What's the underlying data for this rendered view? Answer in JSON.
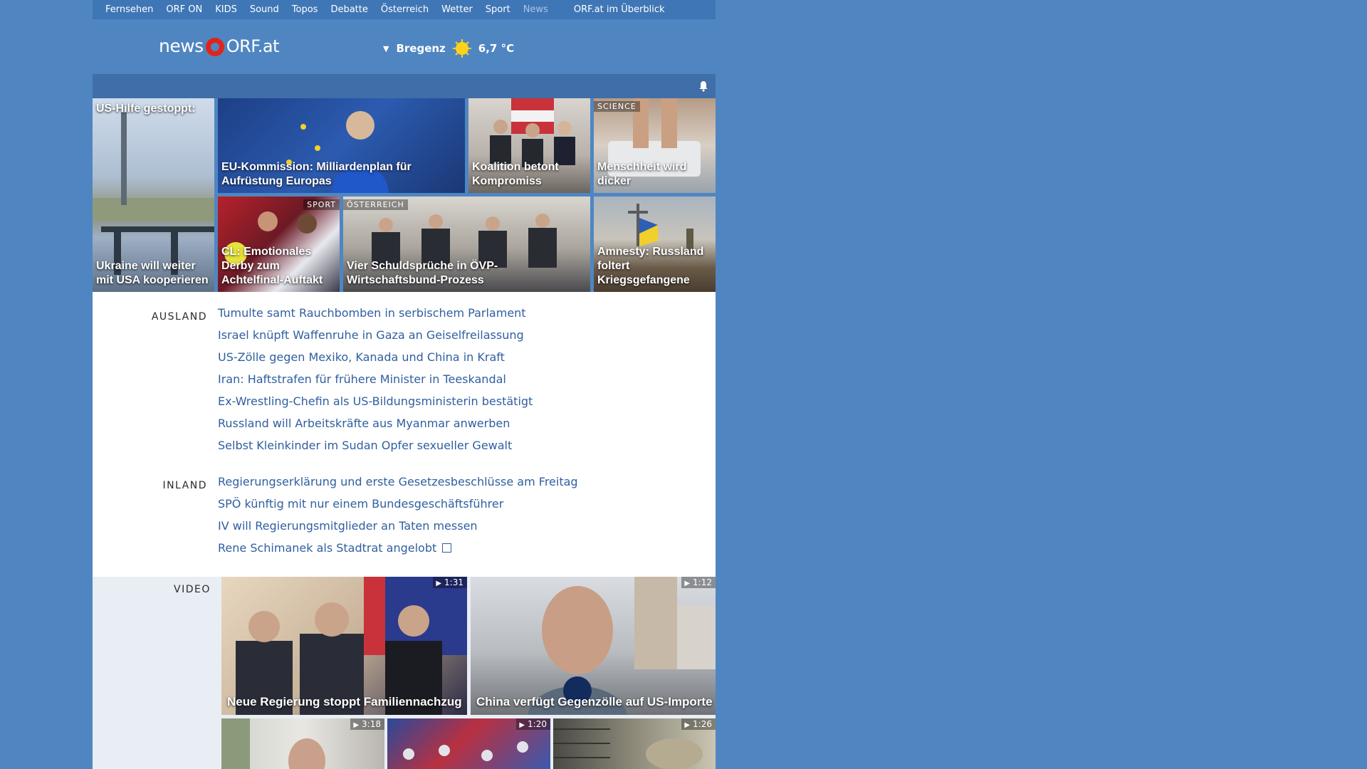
{
  "nav": {
    "items": [
      "Fernsehen",
      "ORF ON",
      "KIDS",
      "Sound",
      "Topos",
      "Debatte",
      "Österreich",
      "Wetter",
      "Sport",
      "News"
    ],
    "active": "News",
    "overview": "ORF.at im Überblick"
  },
  "header": {
    "logo_news": "news",
    "logo_orf": "ORF.at",
    "weather": {
      "city": "Bregenz",
      "temp": "6,7 °C",
      "icon": "sun-icon"
    }
  },
  "tiles": {
    "ukraine": {
      "top": "US-Hilfe gestoppt:",
      "caption": "Ukraine will weiter mit USA kooperieren"
    },
    "eu": {
      "caption": "EU-Kommission: Milliardenplan für Aufrüstung Europas"
    },
    "koalition": {
      "caption": "Koalition betont Kompromiss"
    },
    "science": {
      "tag": "SCIENCE",
      "caption": "Menschheit wird dicker"
    },
    "sport": {
      "tag": "SPORT",
      "caption": "CL: Emotionales Derby zum Achtelfinal-Auftakt"
    },
    "oevp": {
      "tag": "ÖSTERREICH",
      "caption": "Vier Schuldsprüche in ÖVP-Wirtschaftsbund-Prozess"
    },
    "amnesty": {
      "caption": "Amnesty: Russland foltert Kriegsgefangene"
    }
  },
  "ausland": {
    "label": "AUSLAND",
    "links": [
      "Tumulte samt Rauchbomben in serbischem Parlament",
      "Israel knüpft Waffenruhe in Gaza an Geiselfreilassung",
      "US-Zölle gegen Mexiko, Kanada und China in Kraft",
      "Iran: Haftstrafen für frühere Minister in Teeskandal",
      "Ex-Wrestling-Chefin als US-Bildungsministerin bestätigt",
      "Russland will Arbeitskräfte aus Myanmar anwerben",
      "Selbst Kleinkinder im Sudan Opfer sexueller Gewalt"
    ]
  },
  "inland": {
    "label": "INLAND",
    "links": [
      "Regierungserklärung und erste Gesetzesbeschlüsse am Freitag",
      "SPÖ künftig mit nur einem Bundesgeschäftsführer",
      "IV will Regierungsmitglieder an Taten messen",
      "Rene Schimanek als Stadtrat angelobt"
    ]
  },
  "video": {
    "label": "VIDEO",
    "items": [
      {
        "caption": "Neue Regierung stoppt Familiennachzug",
        "duration": "1:31"
      },
      {
        "caption": "China verfügt Gegenzölle auf US-Importe",
        "duration": "1:12"
      },
      {
        "caption": "",
        "duration": "3:18"
      },
      {
        "caption": "",
        "duration": "1:20"
      },
      {
        "caption": "",
        "duration": "1:26"
      }
    ]
  },
  "colors": {
    "background": "#4f86c2",
    "link": "#2f5fa0",
    "orf_red": "#e2231a"
  }
}
